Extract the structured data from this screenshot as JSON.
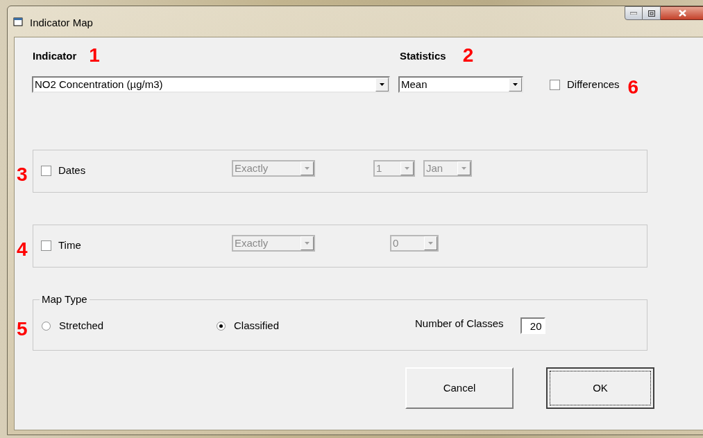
{
  "window": {
    "title": "Indicator Map"
  },
  "indicator": {
    "label": "Indicator",
    "marker": "1",
    "value": "NO2 Concentration (µg/m3)"
  },
  "statistics": {
    "label": "Statistics",
    "marker": "2",
    "value": "Mean"
  },
  "differences": {
    "label": "Differences",
    "checked": false,
    "marker": "6"
  },
  "filters": [
    {
      "marker": "3",
      "label": "Dates",
      "checked": false,
      "dropdowns": [
        {
          "value": "Exactly",
          "disabled": true
        },
        {
          "value": "1",
          "disabled": true
        },
        {
          "value": "Jan",
          "disabled": true
        }
      ]
    },
    {
      "marker": "4",
      "label": "Time",
      "checked": false,
      "dropdowns": [
        {
          "value": "Exactly",
          "disabled": true
        },
        {
          "value": "0",
          "disabled": true
        }
      ]
    }
  ],
  "map_type": {
    "marker": "5",
    "legend": "Map Type",
    "options": [
      {
        "label": "Stretched",
        "selected": false
      },
      {
        "label": "Classified",
        "selected": true
      }
    ],
    "classes_label": "Number of Classes",
    "classes_value": "20"
  },
  "buttons": [
    {
      "label": "Cancel",
      "default": false
    },
    {
      "label": "OK",
      "default": true
    }
  ]
}
